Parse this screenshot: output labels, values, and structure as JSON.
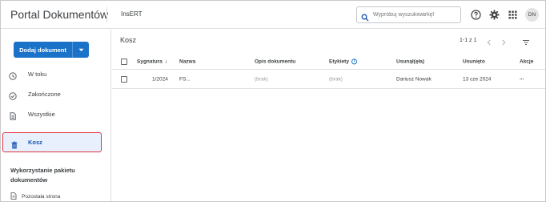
{
  "header": {
    "app_title": "Portal Dokumentów",
    "org_name": "InsERT",
    "search_placeholder": "Wypróbuj wyszukiwarkę!",
    "avatar_initials": "DN",
    "icons": [
      "search-icon",
      "help-icon",
      "gear-icon",
      "apps-grid-icon"
    ]
  },
  "sidebar": {
    "add_button_label": "Dodaj dokument",
    "items": [
      {
        "label": "W toku",
        "icon": "clock-icon"
      },
      {
        "label": "Zakończone",
        "icon": "check-circle-icon"
      },
      {
        "label": "Wszystkie",
        "icon": "documents-icon"
      },
      {
        "label": "Kosz",
        "icon": "trash-icon",
        "active": true
      }
    ],
    "usage_title": "Wykorzystanie pakietu dokumentów",
    "usage_item_label": "Pozostała strona"
  },
  "main": {
    "title": "Kosz",
    "pager_text": "1-1 z 1",
    "columns": [
      "Sygnatura",
      "Nazwa",
      "Opis dokumentu",
      "Etykiety",
      "Usunął(ęła)",
      "Usunięto",
      "Akcje"
    ],
    "rows": [
      {
        "sygnatura": "1/2024",
        "nazwa": "FS...",
        "opis": "(brak)",
        "etykiety": "(brak)",
        "usunal": "Dariusz Nowak",
        "usunieto": "13 cze 2024",
        "akcje": "···"
      }
    ]
  },
  "colors": {
    "accent": "#1a73c8",
    "highlight_border": "#e2333f",
    "active_bg": "#e8f0fe"
  }
}
